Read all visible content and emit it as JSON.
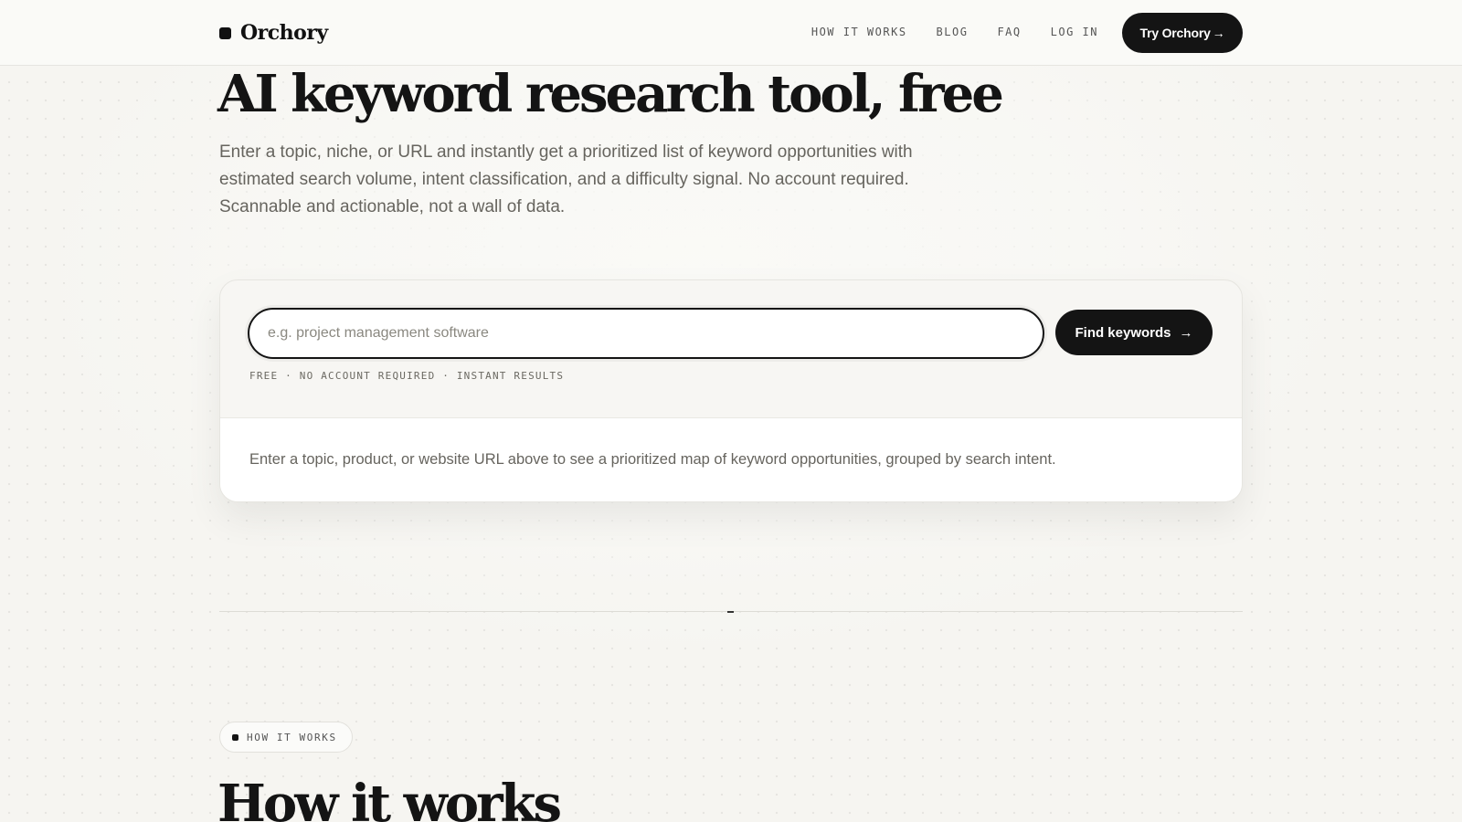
{
  "header": {
    "brand": "Orchory",
    "nav": [
      {
        "label": "HOW IT WORKS"
      },
      {
        "label": "BLOG"
      },
      {
        "label": "FAQ"
      },
      {
        "label": "LOG IN"
      }
    ],
    "cta_label": "Try Orchory",
    "cta_arrow": "→"
  },
  "hero": {
    "title": "AI keyword research tool, free",
    "subtitle": "Enter a topic, niche, or URL and instantly get a prioritized list of keyword opportunities with estimated search volume, intent classification, and a difficulty signal. No account required. Scannable and actionable, not a wall of data."
  },
  "search": {
    "placeholder": "e.g. project management software",
    "value": "",
    "button_label": "Find keywords",
    "button_arrow": "→",
    "meta": "FREE · NO ACCOUNT REQUIRED · INSTANT RESULTS",
    "hint": "Enter a topic, product, or website URL above to see a prioritized map of keyword opportunities, grouped by search intent."
  },
  "how_it_works": {
    "pill_label": "HOW IT WORKS",
    "title": "How it works"
  },
  "colors": {
    "ink": "#141414",
    "muted": "#66645e",
    "background": "#f6f5f1"
  },
  "icons": {
    "logo": "square-logo-icon",
    "arrow": "arrow-right-icon"
  }
}
